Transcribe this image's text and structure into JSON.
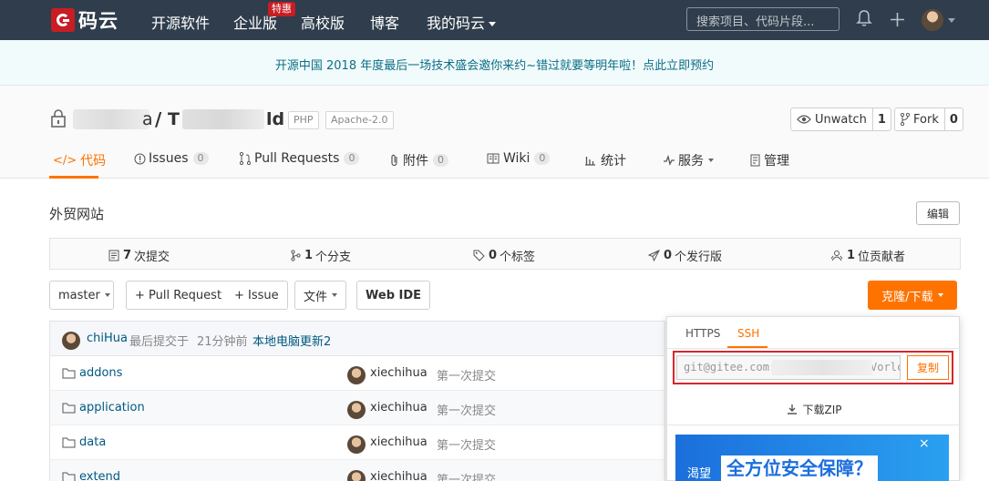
{
  "nav": {
    "brand": "码云",
    "links": [
      "开源软件",
      "企业版",
      "高校版",
      "博客",
      "我的码云"
    ],
    "badge_hot": "特惠",
    "search_placeholder": "搜索项目、代码片段..."
  },
  "banner": {
    "text": "开源中国 2018 年度最后一场技术盛会邀你来约~错过就要等明年啦！点此立即预约"
  },
  "repo": {
    "slash": "/",
    "name_start": "T",
    "name_end": "ld",
    "owner_end": "a",
    "tags": [
      "PHP",
      "Apache-2.0"
    ],
    "watch_label": "Unwatch",
    "watch_count": "1",
    "fork_label": "Fork",
    "fork_count": "0"
  },
  "tabs": [
    {
      "label": "代码"
    },
    {
      "label": "Issues",
      "count": "0"
    },
    {
      "label": "Pull Requests",
      "count": "0"
    },
    {
      "label": "附件",
      "count": "0"
    },
    {
      "label": "Wiki",
      "count": "0"
    },
    {
      "label": "统计"
    },
    {
      "label": "服务"
    },
    {
      "label": "管理"
    }
  ],
  "description": {
    "text": "外贸网站",
    "edit_label": "编辑"
  },
  "stats": [
    {
      "num": "7",
      "label": "次提交"
    },
    {
      "num": "1",
      "label": "个分支"
    },
    {
      "num": "0",
      "label": "个标签"
    },
    {
      "num": "0",
      "label": "个发行版"
    },
    {
      "num": "1",
      "label": "位贡献者"
    }
  ],
  "toolbar": {
    "branch": "master",
    "pull_request": "+ Pull Request",
    "issue": "+ Issue",
    "file": "文件",
    "webide": "Web IDE",
    "clone": "克隆/下载"
  },
  "last_commit": {
    "user": "chiHua",
    "text": "最后提交于",
    "time": "21分钟前",
    "message": "本地电脑更新2"
  },
  "files": [
    {
      "name": "addons",
      "user": "xiechihua",
      "message": "第一次提交"
    },
    {
      "name": "application",
      "user": "xiechihua",
      "message": "第一次提交"
    },
    {
      "name": "data",
      "user": "xiechihua",
      "message": "第一次提交"
    },
    {
      "name": "extend",
      "user": "xiechihua",
      "message": "第一次提交"
    }
  ],
  "clone_panel": {
    "tab_https": "HTTPS",
    "tab_ssh": "SSH",
    "url_start": "git@gitee.com:",
    "url_end": "Vorlc",
    "copy_label": "复制",
    "zip_label": "下载ZIP",
    "ad_small": "渴望",
    "ad_big": "全方位安全保障？",
    "ad_close": "×"
  }
}
